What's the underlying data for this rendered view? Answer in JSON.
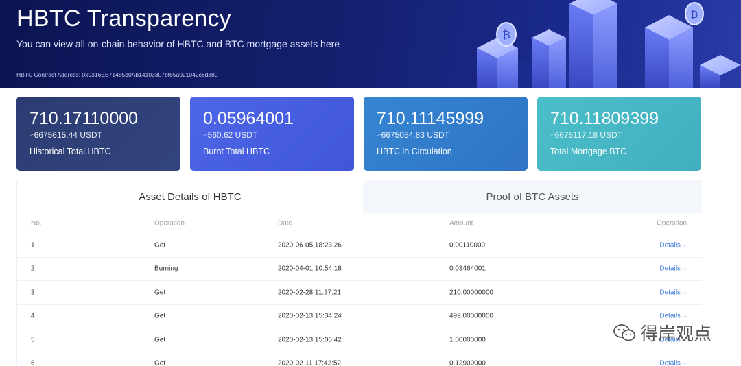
{
  "header": {
    "title": "HBTC Transparency",
    "subtitle": "You can view all on-chain behavior of HBTC and BTC mortgage assets here",
    "contract_address": "HBTC Contract Address: 0x0316EB71485b0Ab14103307bf65a021042c6d380"
  },
  "stats": [
    {
      "value": "710.17110000",
      "usdt": "≈6675615.44 USDT",
      "label": "Historical Total HBTC"
    },
    {
      "value": "0.05964001",
      "usdt": "≈560.62 USDT",
      "label": "Burnt Total HBTC"
    },
    {
      "value": "710.11145999",
      "usdt": "≈6675054.83 USDT",
      "label": "HBTC in Circulation"
    },
    {
      "value": "710.11809399",
      "usdt": "≈6675117.18 USDT",
      "label": "Total Mortgage BTC"
    }
  ],
  "tabs": {
    "active": "Asset Details of HBTC",
    "inactive": "Proof of BTC Assets"
  },
  "table": {
    "headers": {
      "no": "No.",
      "operation": "Operation",
      "date": "Date",
      "amount": "Amount",
      "action": "Operation"
    },
    "rows": [
      {
        "no": "1",
        "operation": "Get",
        "date": "2020-06-05 18:23:26",
        "amount": "0.00110000",
        "action": "Details"
      },
      {
        "no": "2",
        "operation": "Burning",
        "date": "2020-04-01 10:54:18",
        "amount": "0.03464001",
        "action": "Details"
      },
      {
        "no": "3",
        "operation": "Get",
        "date": "2020-02-28 11:37:21",
        "amount": "210.00000000",
        "action": "Details"
      },
      {
        "no": "4",
        "operation": "Get",
        "date": "2020-02-13 15:34:24",
        "amount": "499.00000000",
        "action": "Details"
      },
      {
        "no": "5",
        "operation": "Get",
        "date": "2020-02-13 15:06:42",
        "amount": "1.00000000",
        "action": "Details"
      },
      {
        "no": "6",
        "operation": "Get",
        "date": "2020-02-11 17:42:52",
        "amount": "0.12900000",
        "action": "Details"
      }
    ]
  },
  "watermark": {
    "text": "得岸观点"
  },
  "icons": {
    "chevron": "chevron-down-icon",
    "watermark": "wechat-icon"
  },
  "colors": {
    "banner": "#14206e",
    "details_link": "#3d7bdc",
    "card1": "#2c3c72",
    "card2": "#4e66e8",
    "card3": "#3586d2",
    "card4": "#4bbfc9"
  }
}
